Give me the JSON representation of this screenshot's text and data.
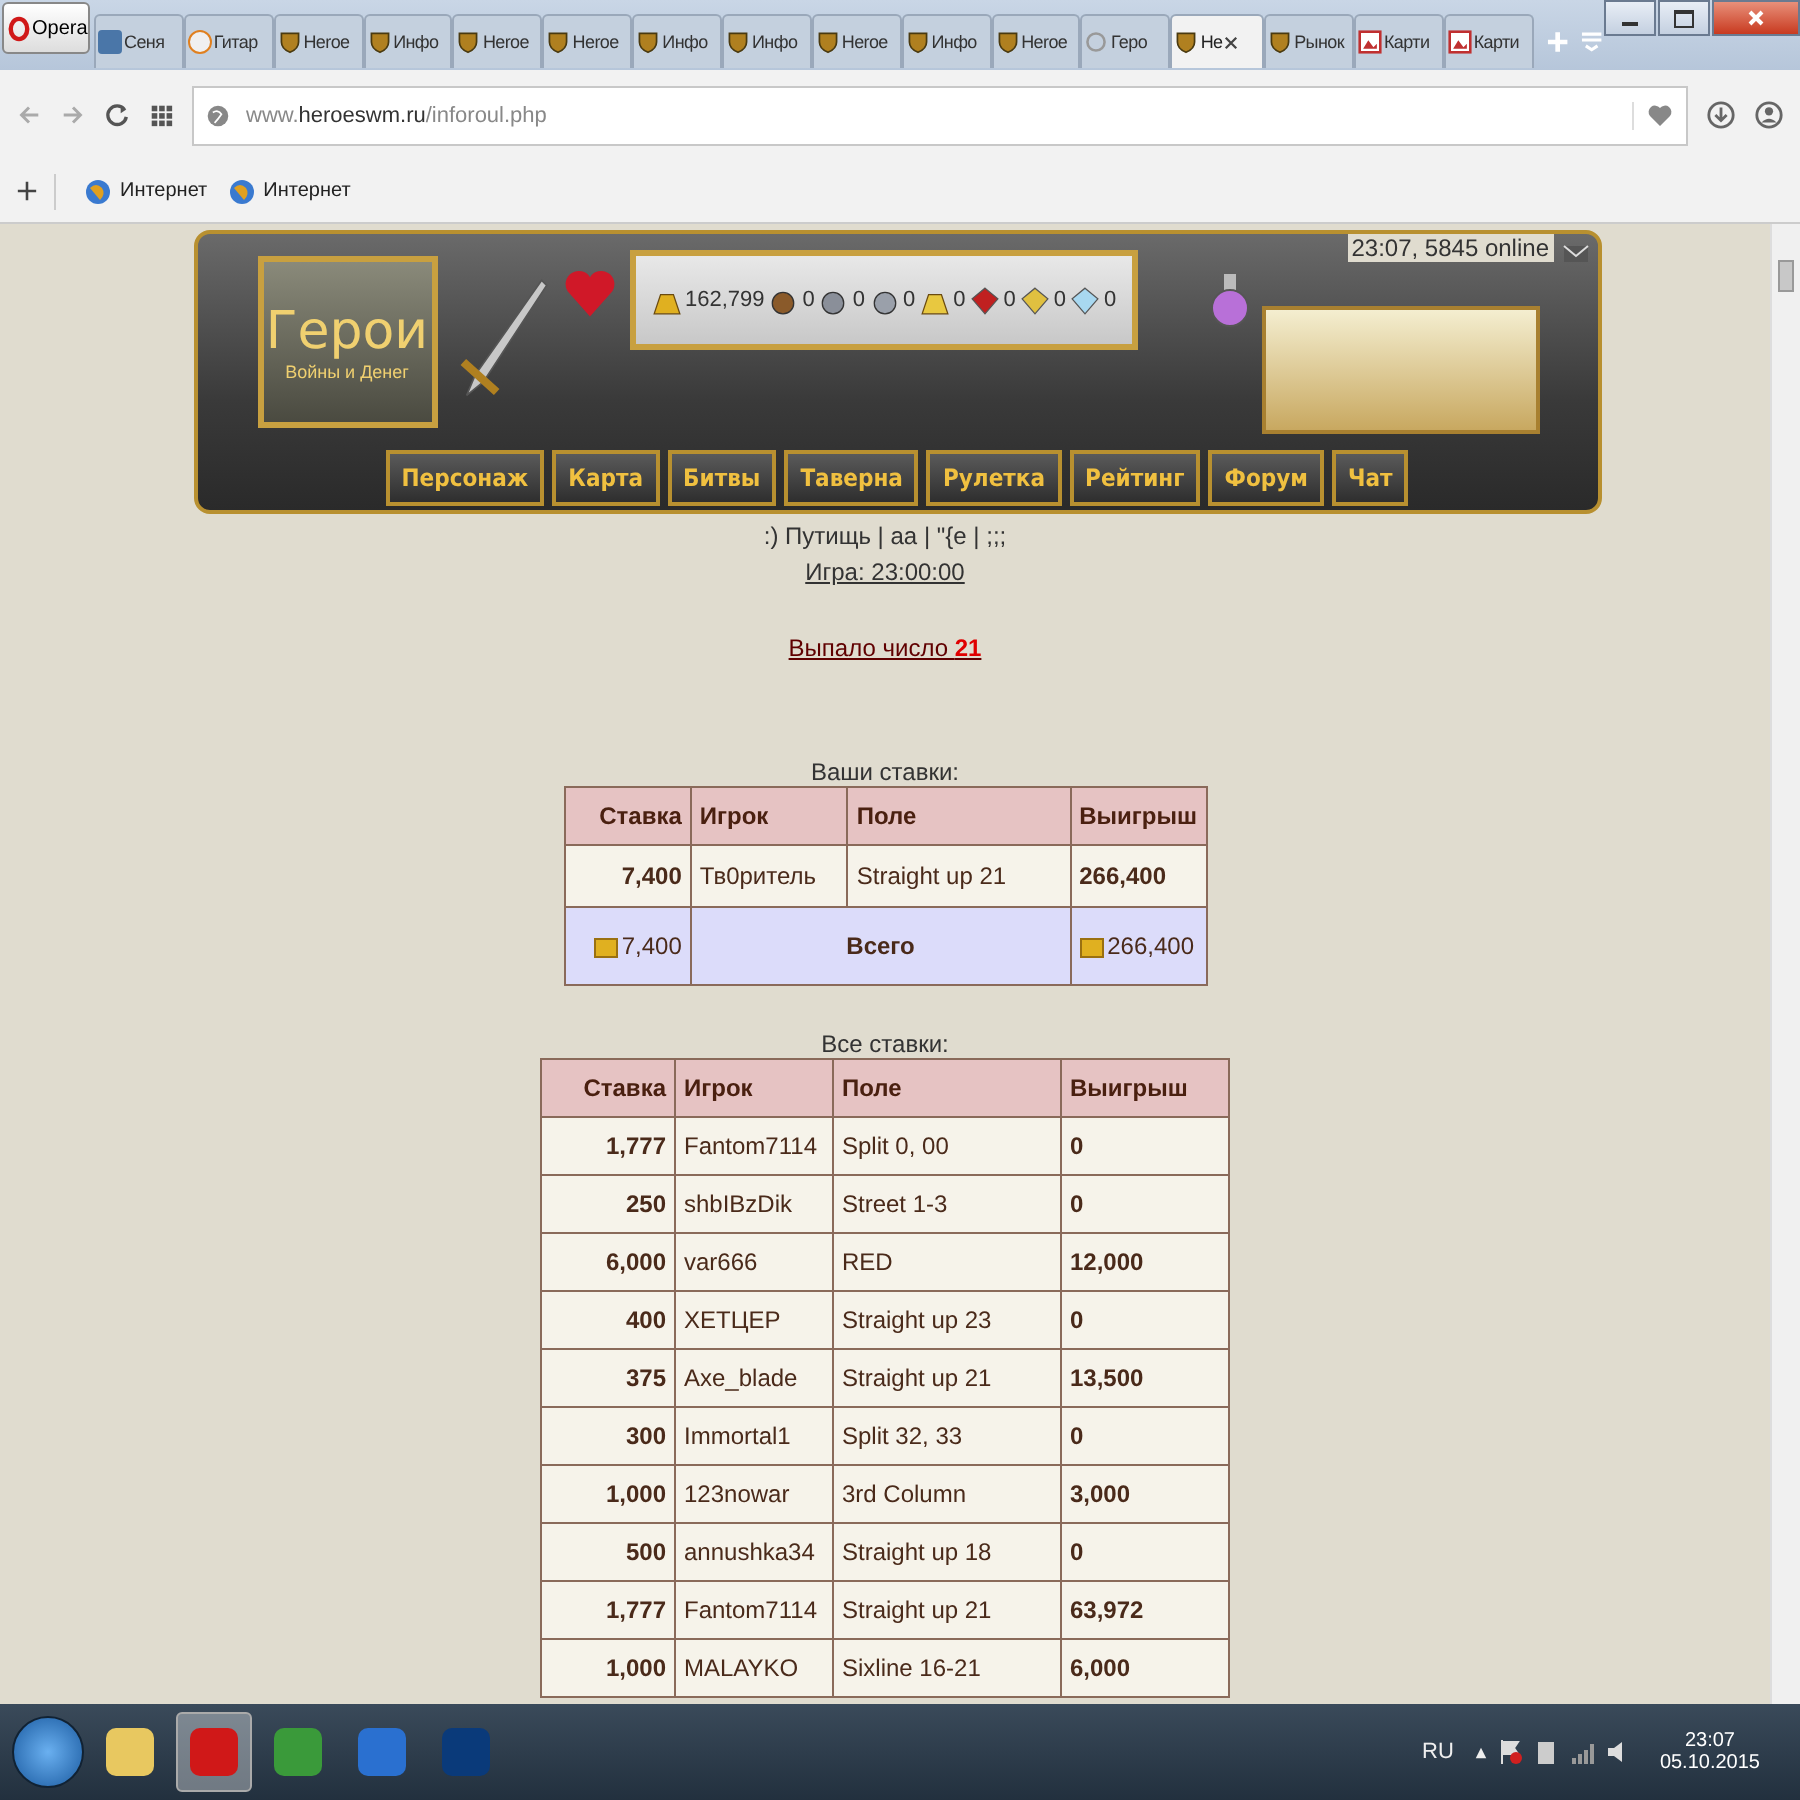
{
  "browser": {
    "menu_label": "Opera",
    "tabs": [
      {
        "kind": "vk",
        "label": "Сеня",
        "selected": false
      },
      {
        "kind": "ok",
        "label": "Гитар",
        "selected": false
      },
      {
        "kind": "hwm",
        "label": "Heroe",
        "selected": false
      },
      {
        "kind": "hwm",
        "label": "Инфо",
        "selected": false
      },
      {
        "kind": "hwm",
        "label": "Heroe",
        "selected": false
      },
      {
        "kind": "hwm",
        "label": "Heroe",
        "selected": false
      },
      {
        "kind": "hwm",
        "label": "Инфо",
        "selected": false
      },
      {
        "kind": "hwm",
        "label": "Инфо",
        "selected": false
      },
      {
        "kind": "hwm",
        "label": "Heroe",
        "selected": false
      },
      {
        "kind": "hwm",
        "label": "Инфо",
        "selected": false
      },
      {
        "kind": "hwm",
        "label": "Heroe",
        "selected": false
      },
      {
        "kind": "loading",
        "label": "Геро",
        "selected": false
      },
      {
        "kind": "hwm",
        "label": "Не",
        "selected": true
      },
      {
        "kind": "hwm",
        "label": "Рынок",
        "selected": false
      },
      {
        "kind": "picture",
        "label": "Карти",
        "selected": false
      },
      {
        "kind": "picture",
        "label": "Карти",
        "selected": false
      }
    ],
    "address": {
      "prefix": "www.",
      "domain": "heroeswm.ru",
      "path": "/inforoul.php"
    },
    "bookmarks": [
      {
        "label": "Интернет"
      },
      {
        "label": "Интернет"
      }
    ]
  },
  "header": {
    "logo_title": "Герои",
    "logo_subtitle": "Войны и Денег",
    "online": "23:07, 5845 online",
    "resources": [
      {
        "kind": "gold",
        "value": "162,799"
      },
      {
        "kind": "wood",
        "value": "0"
      },
      {
        "kind": "ore",
        "value": "0"
      },
      {
        "kind": "mercury",
        "value": "0"
      },
      {
        "kind": "sulfur",
        "value": "0"
      },
      {
        "kind": "crystal",
        "value": "0"
      },
      {
        "kind": "gems",
        "value": "0"
      },
      {
        "kind": "diamond",
        "value": "0"
      }
    ],
    "nav": [
      "Персонаж",
      "Карта",
      "Битвы",
      "Таверна",
      "Рулетка",
      "Рейтинг",
      "Форум",
      "Чат"
    ]
  },
  "links": ":) Путищь | аа | \"{е | ;;;",
  "game_time": "Игра: 23:00:00",
  "result": {
    "label": "Выпало число",
    "number": "21"
  },
  "my_bets": {
    "caption": "Ваши ставки:",
    "columns": [
      "Ставка",
      "Игрок",
      "Поле",
      "Выигрыш"
    ],
    "rows": [
      {
        "bet": "7,400",
        "player": "Тв0ритель",
        "field": "Straight up 21",
        "win": "266,400"
      }
    ],
    "total": {
      "bet": "7,400",
      "label": "Всего",
      "win": "266,400"
    }
  },
  "all_bets": {
    "caption": "Все ставки:",
    "columns": [
      "Ставка",
      "Игрок",
      "Поле",
      "Выигрыш"
    ],
    "rows": [
      {
        "bet": "1,777",
        "player": "Fantom7114",
        "field": "Split 0, 00",
        "win": "0"
      },
      {
        "bet": "250",
        "player": "shbIBzDik",
        "field": "Street 1-3",
        "win": "0"
      },
      {
        "bet": "6,000",
        "player": "var666",
        "field": "RED",
        "win": "12,000"
      },
      {
        "bet": "400",
        "player": "XETЦEP",
        "field": "Straight up 23",
        "win": "0"
      },
      {
        "bet": "375",
        "player": "Axe_blade",
        "field": "Straight up 21",
        "win": "13,500"
      },
      {
        "bet": "300",
        "player": "Immortal1",
        "field": "Split 32, 33",
        "win": "0"
      },
      {
        "bet": "1,000",
        "player": "123nowar",
        "field": "3rd Column",
        "win": "3,000"
      },
      {
        "bet": "500",
        "player": "annushka34",
        "field": "Straight up 18",
        "win": "0"
      },
      {
        "bet": "1,777",
        "player": "Fantom7114",
        "field": "Straight up 21",
        "win": "63,972"
      },
      {
        "bet": "1,000",
        "player": "MALAYKO",
        "field": "Sixline 16-21",
        "win": "6,000"
      }
    ]
  },
  "taskbar": {
    "apps": [
      {
        "kind": "folder",
        "selected": false
      },
      {
        "kind": "opera",
        "selected": true
      },
      {
        "kind": "chrome",
        "selected": false
      },
      {
        "kind": "ie",
        "selected": false
      },
      {
        "kind": "ps",
        "selected": false
      }
    ],
    "language": "RU",
    "time": "23:07",
    "date": "05.10.2015"
  }
}
